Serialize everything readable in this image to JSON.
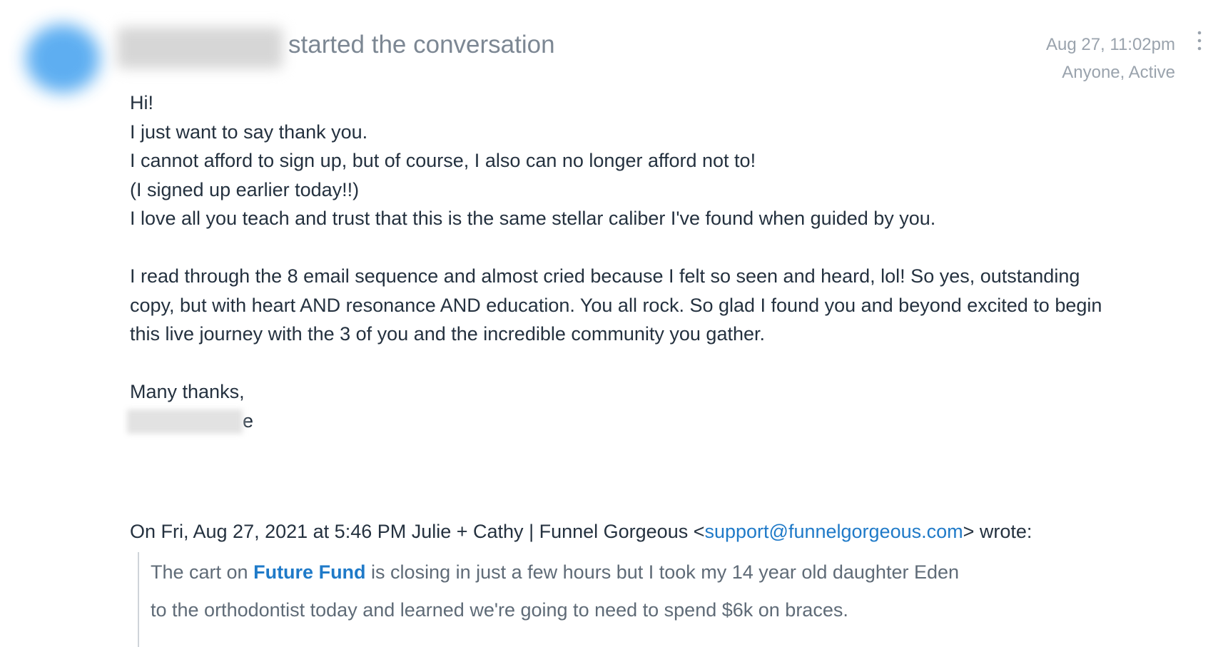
{
  "header": {
    "started_label": "started the conversation",
    "timestamp": "Aug 27, 11:02pm",
    "visibility_status": "Anyone, Active",
    "more_icon": "more-vertical-icon"
  },
  "message": {
    "lines": [
      "Hi!",
      "I just want to say thank you.",
      "I cannot afford to sign up, but of course, I also can no longer afford not to!",
      "(I signed up earlier today!!)",
      "I love all you teach and trust that this is the same stellar caliber I've found when guided by you."
    ],
    "paragraph2": [
      "I read through the 8 email sequence and almost cried because I felt so seen and heard, lol! So yes, outstanding",
      "copy, but with heart AND resonance AND education. You all rock. So glad I found you and beyond excited to begin",
      "this live journey with the 3 of you and the incredible community you gather."
    ],
    "closing": "Many thanks,",
    "signature_tail": "e"
  },
  "quote": {
    "attribution_prefix": "On Fri, Aug 27, 2021 at 5:46 PM Julie + Cathy | Funnel Gorgeous <",
    "attribution_email": "support@funnelgorgeous.com",
    "attribution_suffix": "> wrote:",
    "line1_prefix": "The cart on ",
    "line1_link": "Future Fund",
    "line1_suffix": " is closing in just a few hours but I took my 14 year old daughter Eden",
    "line2": "to the orthodontist today and learned we're going to need to spend $6k on braces."
  },
  "colors": {
    "text": "#24313f",
    "muted": "#7c8793",
    "meta": "#9aa3ad",
    "link": "#1f7ac8",
    "avatar": "#4da6f0"
  }
}
